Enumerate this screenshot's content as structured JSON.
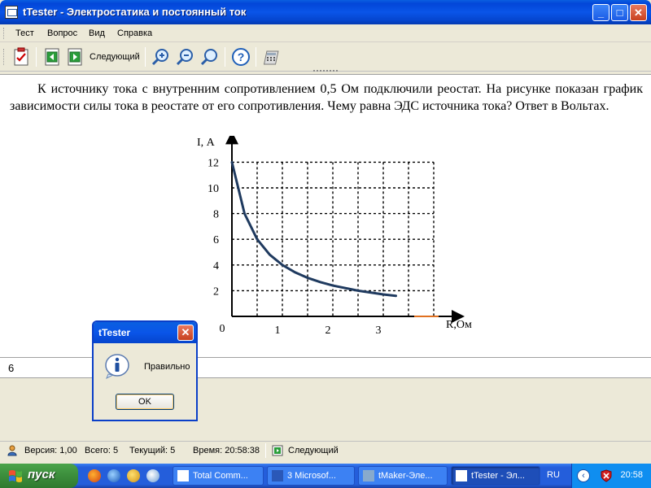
{
  "window": {
    "title": "tTester - Электростатика и постоянный ток",
    "minimize": "_",
    "maximize": "□",
    "close": "✕"
  },
  "menu": [
    "Тест",
    "Вопрос",
    "Вид",
    "Справка"
  ],
  "toolbar": {
    "next_label": "Следующий",
    "icons": [
      "checklist-icon",
      "back-icon",
      "forward-icon",
      "zoom-in-icon",
      "zoom-out-icon",
      "zoom-icon",
      "help-icon",
      "calculator-icon"
    ]
  },
  "question": {
    "text": "К источнику тока с внутренним сопротивлением 0,5 Ом подключили реостат. На рисунке показан график зависимости силы тока в реостате от его сопротивления. Чему равна ЭДС источника тока? Ответ в Вольтах."
  },
  "chart_data": {
    "type": "line",
    "xlabel": "R,Ом",
    "ylabel": "I, А",
    "x_ticks": [
      {
        "v": 0,
        "label": "0"
      },
      {
        "v": 1,
        "label": "1"
      },
      {
        "v": 2,
        "label": "2"
      },
      {
        "v": 3,
        "label": "3"
      }
    ],
    "y_ticks": [
      {
        "v": 2,
        "label": "2"
      },
      {
        "v": 4,
        "label": "4"
      },
      {
        "v": 6,
        "label": "6"
      },
      {
        "v": 8,
        "label": "8"
      },
      {
        "v": 10,
        "label": "10"
      },
      {
        "v": 12,
        "label": "12"
      }
    ],
    "xlim": [
      0,
      4
    ],
    "ylim": [
      0,
      12
    ],
    "grid": true,
    "series": [
      {
        "x": [
          0,
          0.25,
          0.5,
          0.75,
          1,
          1.25,
          1.5,
          1.75,
          2,
          2.5,
          3,
          3.25
        ],
        "y": [
          12,
          8,
          6,
          4.8,
          4,
          3.43,
          3,
          2.67,
          2.4,
          2,
          1.71,
          1.6
        ]
      }
    ],
    "line_color": "#1f3a5f"
  },
  "answer": {
    "value": "6"
  },
  "dialog": {
    "title": "tTester",
    "message": "Правильно",
    "ok": "OK",
    "close": "✕"
  },
  "status": {
    "version": "Версия: 1,00",
    "total": "Всего: 5",
    "current": "Текущий: 5",
    "time": "Время: 20:58:38",
    "next": "Следующий"
  },
  "taskbar": {
    "start": "пуск",
    "tasks": [
      "Total Comm...",
      "3 Microsof...",
      "tMaker-Эле...",
      "tTester - Эл..."
    ],
    "lang": "RU",
    "clock": "20:58"
  }
}
